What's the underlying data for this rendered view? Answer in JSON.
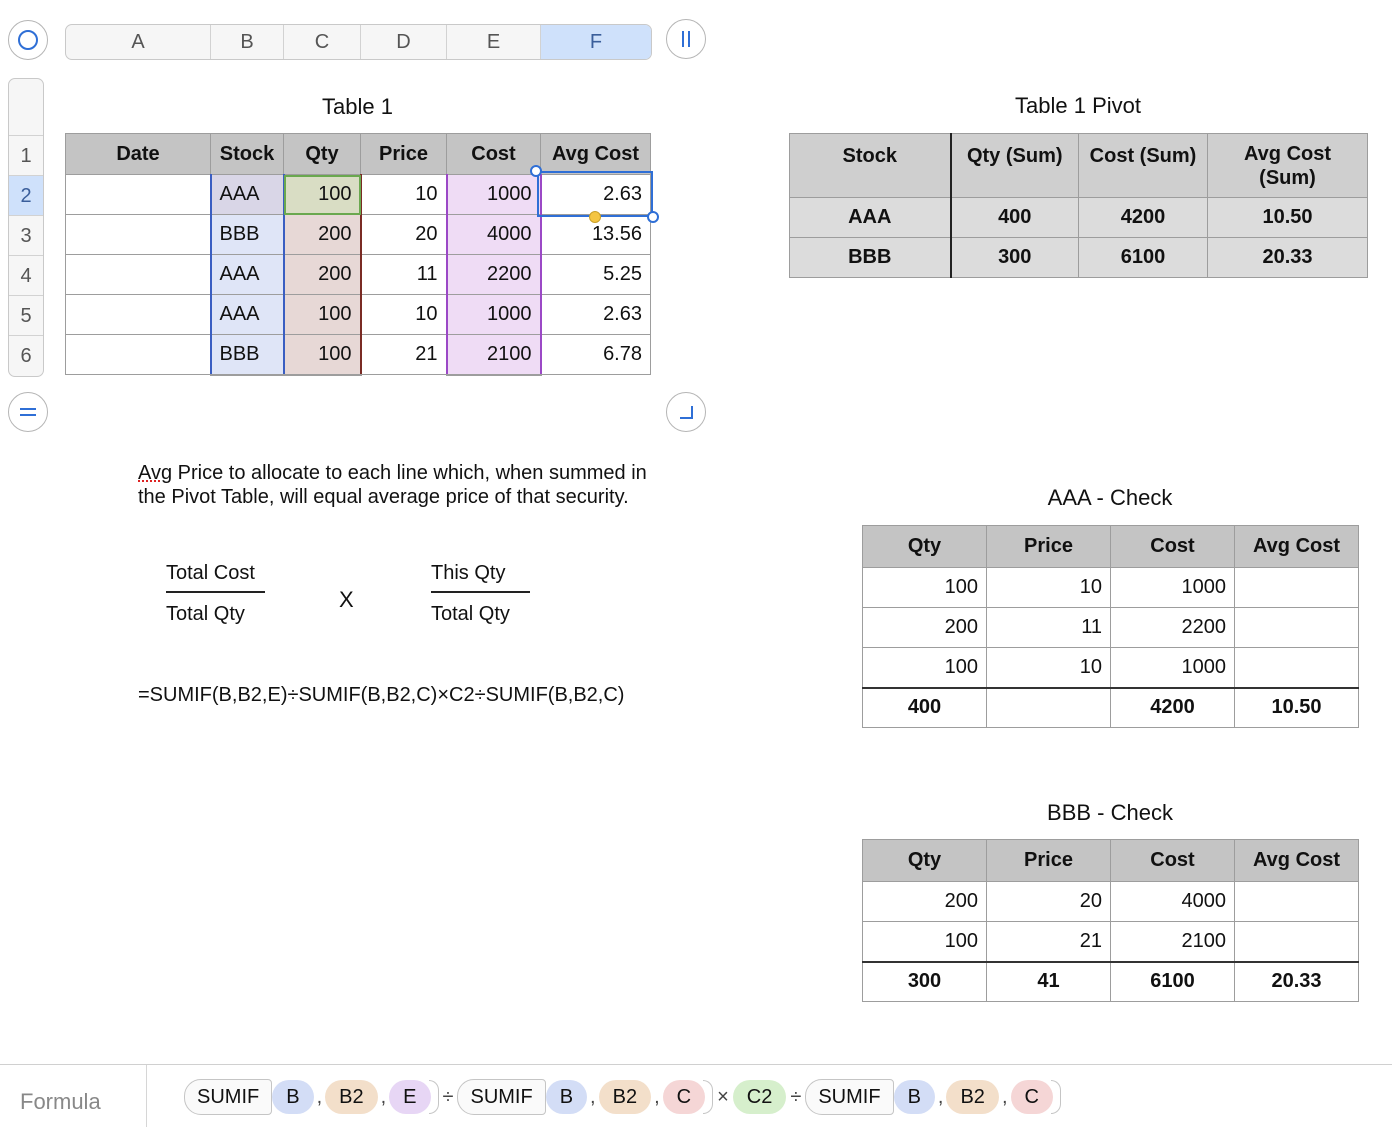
{
  "column_headers": [
    "A",
    "B",
    "C",
    "D",
    "E",
    "F"
  ],
  "selected_column": "F",
  "row_headers": [
    "1",
    "2",
    "3",
    "4",
    "5",
    "6"
  ],
  "table1": {
    "title": "Table 1",
    "headers": [
      "Date",
      "Stock",
      "Qty",
      "Price",
      "Cost",
      "Avg Cost"
    ],
    "rows": [
      [
        "",
        "AAA",
        "100",
        "10",
        "1000",
        "2.63"
      ],
      [
        "",
        "BBB",
        "200",
        "20",
        "4000",
        "13.56"
      ],
      [
        "",
        "AAA",
        "200",
        "11",
        "2200",
        "5.25"
      ],
      [
        "",
        "AAA",
        "100",
        "10",
        "1000",
        "2.63"
      ],
      [
        "",
        "BBB",
        "100",
        "21",
        "2100",
        "6.78"
      ]
    ]
  },
  "pivot": {
    "title": "Table 1 Pivot",
    "headers": [
      "Stock",
      "Qty (Sum)",
      "Cost (Sum)",
      "Avg Cost (Sum)"
    ],
    "rows": [
      [
        "AAA",
        "400",
        "4200",
        "10.50"
      ],
      [
        "BBB",
        "300",
        "6100",
        "20.33"
      ]
    ]
  },
  "note": {
    "first_word": "Avg",
    "rest": " Price to allocate to each line which, when summed in the Pivot Table, will equal average price of that security.",
    "frac1_num": "Total Cost",
    "frac1_den": "Total Qty",
    "times": "X",
    "frac2_num": "This Qty",
    "frac2_den": "Total Qty",
    "formula": "=SUMIF(B,B2,E)÷SUMIF(B,B2,C)×C2÷SUMIF(B,B2,C)"
  },
  "aaa_check": {
    "title": "AAA - Check",
    "headers": [
      "Qty",
      "Price",
      "Cost",
      "Avg Cost"
    ],
    "rows": [
      [
        "100",
        "10",
        "1000",
        ""
      ],
      [
        "200",
        "11",
        "2200",
        ""
      ],
      [
        "100",
        "10",
        "1000",
        ""
      ]
    ],
    "total": [
      "400",
      "",
      "4200",
      "10.50"
    ]
  },
  "bbb_check": {
    "title": "BBB - Check",
    "headers": [
      "Qty",
      "Price",
      "Cost",
      "Avg Cost"
    ],
    "rows": [
      [
        "200",
        "20",
        "4000",
        ""
      ],
      [
        "100",
        "21",
        "2100",
        ""
      ]
    ],
    "total": [
      "300",
      "41",
      "6100",
      "20.33"
    ]
  },
  "formula_bar": {
    "label": "Formula",
    "tokens": [
      "SUMIF",
      "B",
      "B2",
      "E",
      "÷",
      "SUMIF",
      "B",
      "B2",
      "C",
      "×",
      "C2",
      "÷",
      "SUMIF",
      "B",
      "B2",
      "C"
    ]
  },
  "colors": {
    "selection_blue": "#cfe1fb",
    "stock_ref": "#d3ddf6",
    "qty_ref": "#f5d6d6",
    "cost_ref": "#e7d6f5",
    "c2_ref": "#d6efcc",
    "b2_ref": "#f3dfca"
  }
}
